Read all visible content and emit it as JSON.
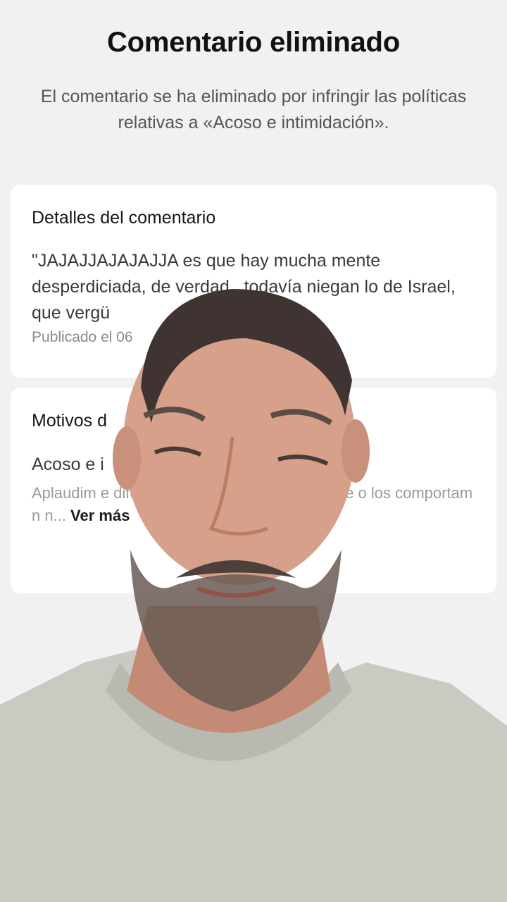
{
  "header": {
    "title": "Comentario eliminado",
    "subtitle": "El comentario se ha eliminado por infringir las políticas relativas a «Acoso e intimidación»."
  },
  "details_card": {
    "title": "Detalles del comentario",
    "comment": "\"JAJAJJAJAJAJJA es que hay mucha mente desperdiciada, de verdad...todavía niegan lo de Israel, que vergü",
    "published": "Publicado el 06"
  },
  "reasons_card": {
    "title": "Motivos d",
    "reason_name": "Acoso e i",
    "description": "Aplaudim                e diferentes puntos de              la provocaci             e o los comportam             n n...",
    "see_more_label": " Ver más"
  },
  "colors": {
    "background": "#f1f1f1",
    "card": "#ffffff",
    "title_text": "#111111",
    "subtitle_text": "#555555",
    "muted_text": "#9a9a9a",
    "shirt": "#c9cbc3",
    "skin": "#d7a08a",
    "beard": "#5a4b45"
  }
}
